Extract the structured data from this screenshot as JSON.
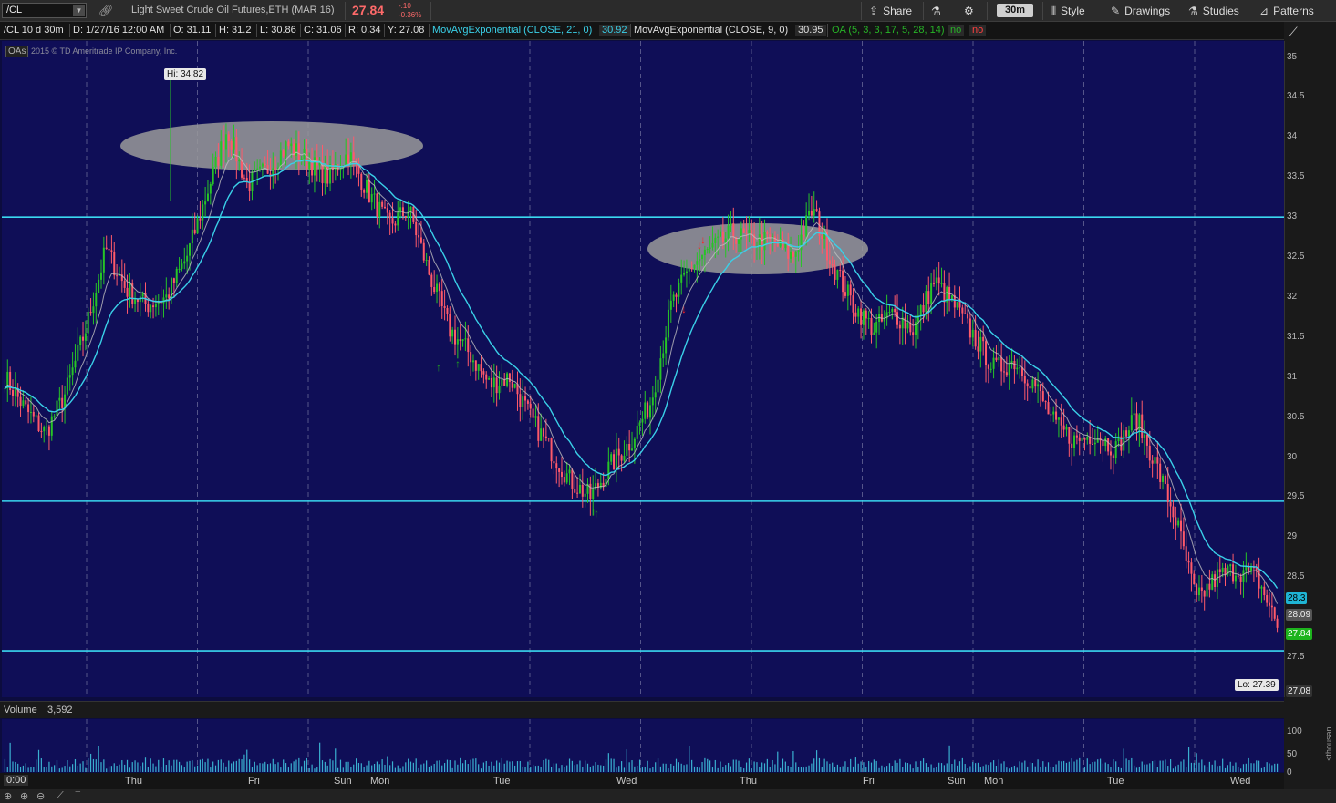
{
  "toolbar": {
    "symbol": "/CL",
    "instrument_desc": "Light Sweet Crude Oil Futures,ETH (MAR 16)",
    "last_price": "27.84",
    "net_change": "-.10",
    "pct_change": "-0.36%",
    "share_label": "Share",
    "timeframe": "30m",
    "style_label": "Style",
    "drawings_label": "Drawings",
    "studies_label": "Studies",
    "patterns_label": "Patterns"
  },
  "infobar": {
    "chart_id": "/CL 10 d 30m",
    "date": "D: 1/27/16 12:00 AM",
    "open": "O: 31.11",
    "high": "H: 31.2",
    "low": "L: 30.86",
    "close": "C: 31.06",
    "range": "R: 0.34",
    "y": "Y: 27.08",
    "ema21_name": "MovAvgExponential (CLOSE, 21, 0)",
    "ema21_value": "30.92",
    "ema9_name": "MovAvgExponential (CLOSE, 9, 0)",
    "ema9_value": "30.95",
    "oa_name": "OA (5, 3, 3, 17, 5, 28, 14)",
    "oa_flag1": "no",
    "oa_flag2": "no"
  },
  "price_pane": {
    "oas_tag": "OAs",
    "copyright": "2015 © TD Ameritrade IP Company, Inc.",
    "hi_label": "Hi: 34.82",
    "lo_label": "Lo: 27.39",
    "badges": {
      "ema21": "28.3",
      "ema9": "28.09",
      "last": "27.84",
      "low": "27.08"
    }
  },
  "volume": {
    "label": "Volume",
    "value": "3,592",
    "unit": "<thousan...",
    "axis": [
      "100",
      "50",
      "0"
    ]
  },
  "time_axis": {
    "start": "0:00",
    "labels": [
      "Thu",
      "Fri",
      "Sun",
      "Mon",
      "Tue",
      "Wed",
      "Thu",
      "Fri",
      "Sun",
      "Mon",
      "Tue",
      "Wed"
    ]
  },
  "colors": {
    "background": "#0f0e57",
    "up_candle": "#27c427",
    "down_candle": "#ff5a6a",
    "ema21": "#3ad0e8",
    "ema9": "#c0c0c0",
    "horizontal_lines": "#3ad8f0",
    "highlight": "#9a9a9a"
  },
  "chart_data": {
    "type": "candlestick",
    "interval": "30m",
    "ylim": [
      27.0,
      35.2
    ],
    "y_ticks": [
      35,
      34.5,
      34,
      33.5,
      33,
      32.5,
      32,
      31.5,
      31,
      30.5,
      30,
      29.5,
      29,
      28.5,
      28,
      27.5
    ],
    "x_labels": [
      "Thu",
      "Fri",
      "Sun",
      "Mon",
      "Tue",
      "Wed",
      "Thu",
      "Fri",
      "Sun",
      "Mon",
      "Tue",
      "Wed"
    ],
    "session_dividers": 11,
    "high": 34.82,
    "low": 27.39,
    "horizontal_levels": [
      33.0,
      29.45,
      27.58
    ],
    "close_path": [
      31.0,
      30.6,
      30.3,
      30.8,
      31.6,
      32.6,
      32.1,
      31.9,
      32.0,
      32.5,
      33.3,
      34.1,
      33.4,
      33.6,
      33.9,
      33.7,
      33.5,
      33.8,
      33.3,
      32.9,
      33.1,
      32.3,
      31.6,
      31.3,
      30.9,
      31.0,
      30.5,
      30.1,
      29.7,
      29.5,
      29.9,
      30.2,
      30.7,
      31.9,
      32.4,
      32.6,
      32.8,
      32.7,
      32.7,
      32.5,
      33.1,
      32.4,
      31.9,
      31.6,
      31.8,
      31.6,
      32.2,
      31.9,
      31.5,
      31.1,
      31.2,
      30.9,
      30.4,
      30.2,
      30.3,
      30.1,
      30.5,
      29.9,
      29.2,
      28.2,
      28.5,
      28.6,
      28.5,
      27.9
    ],
    "ema21_last": 28.3,
    "ema9_last": 28.09,
    "last": 27.84,
    "volume_axis": [
      100,
      50,
      0
    ],
    "volume_unit": "thousands"
  }
}
